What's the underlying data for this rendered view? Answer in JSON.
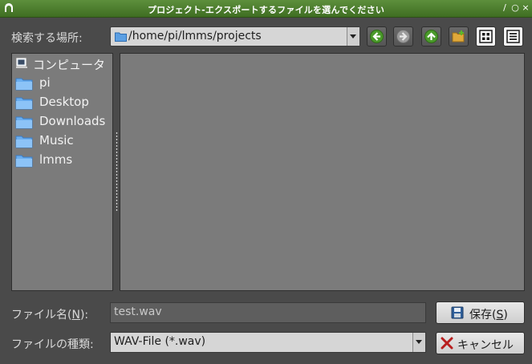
{
  "window": {
    "title": "プロジェクト-エクスポートするファイルを選んでください",
    "buttons": [
      "/",
      "○",
      "×"
    ]
  },
  "location": {
    "label": "検索する場所:",
    "path": "/home/pi/lmms/projects"
  },
  "toolbar": {
    "icons": [
      "back-arrow-icon",
      "forward-arrow-icon",
      "up-arrow-icon",
      "new-folder-icon",
      "icon-view-icon",
      "list-view-icon"
    ]
  },
  "sidebar": {
    "items": [
      {
        "label": "コンピュータ",
        "icon": "computer-icon"
      },
      {
        "label": "pi",
        "icon": "folder-icon"
      },
      {
        "label": "Desktop",
        "icon": "folder-icon"
      },
      {
        "label": "Downloads",
        "icon": "folder-icon"
      },
      {
        "label": "Music",
        "icon": "folder-icon"
      },
      {
        "label": "lmms",
        "icon": "folder-icon"
      }
    ]
  },
  "filename": {
    "label_pre": "ファイル名(",
    "label_key": "N",
    "label_post": "):",
    "value": "test.wav"
  },
  "filetype": {
    "label": "ファイルの種類:",
    "value": "WAV-File (*.wav)"
  },
  "save_button": {
    "label_pre": "保存(",
    "label_key": "S",
    "label_post": ")"
  },
  "cancel_button": {
    "label": "キャンセル"
  },
  "colors": {
    "titlebar": "#4f7f2f",
    "accent": "#5aa02c",
    "panel": "#7b7b7b",
    "background": "#4a4a4a"
  }
}
